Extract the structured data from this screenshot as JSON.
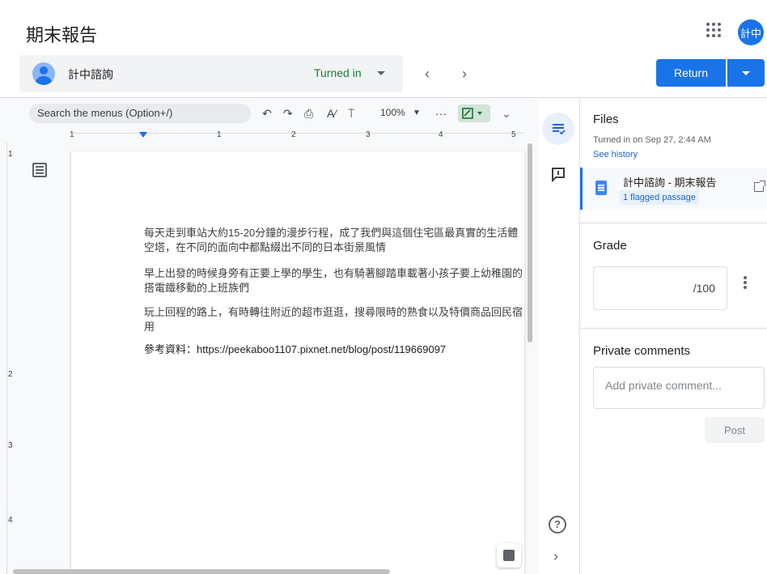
{
  "header": {
    "title": "期末報告",
    "user_initials": "計中"
  },
  "student_bar": {
    "name": "計中諮詢",
    "status": "Turned in",
    "prev": "‹",
    "next": "›"
  },
  "actions": {
    "return_label": "Return"
  },
  "doc_toolbar": {
    "search_placeholder": "Search the menus (Option+/)",
    "zoom": "100%",
    "more": "···",
    "ruler_numbers": [
      "1",
      "1",
      "2",
      "3",
      "4",
      "5"
    ],
    "vruler_numbers": [
      "1",
      "2",
      "3",
      "4"
    ]
  },
  "document": {
    "paragraphs": [
      "每天走到車站大約15-20分鐘的漫步行程，成了我們與這個住宅區最真實的生活體\n空塔，在不同的面向中都點綴出不同的日本街景風情",
      "早上出發的時候身旁有正要上學的學生，也有騎著腳踏車載著小孩子要上幼稚園的\n搭電鐵移動的上班族們",
      "玩上回程的路上，有時轉往附近的超市逛逛，搜尋限時的熟食以及特價商品回民宿\n用"
    ],
    "reference": "參考資料：https://peekaboo1107.pixnet.net/blog/post/119669097"
  },
  "files": {
    "heading": "Files",
    "turned_on": "Turned in on Sep 27, 2:44 AM",
    "see_history": "See history",
    "file_name": "計中諮詢 - 期末報告",
    "flagged": "1 flagged passage"
  },
  "grade": {
    "heading": "Grade",
    "denominator": "/100"
  },
  "private_comments": {
    "heading": "Private comments",
    "placeholder": "Add private comment...",
    "post_label": "Post"
  },
  "colors": {
    "accent": "#1a73e8",
    "turned_in": "#188038"
  }
}
